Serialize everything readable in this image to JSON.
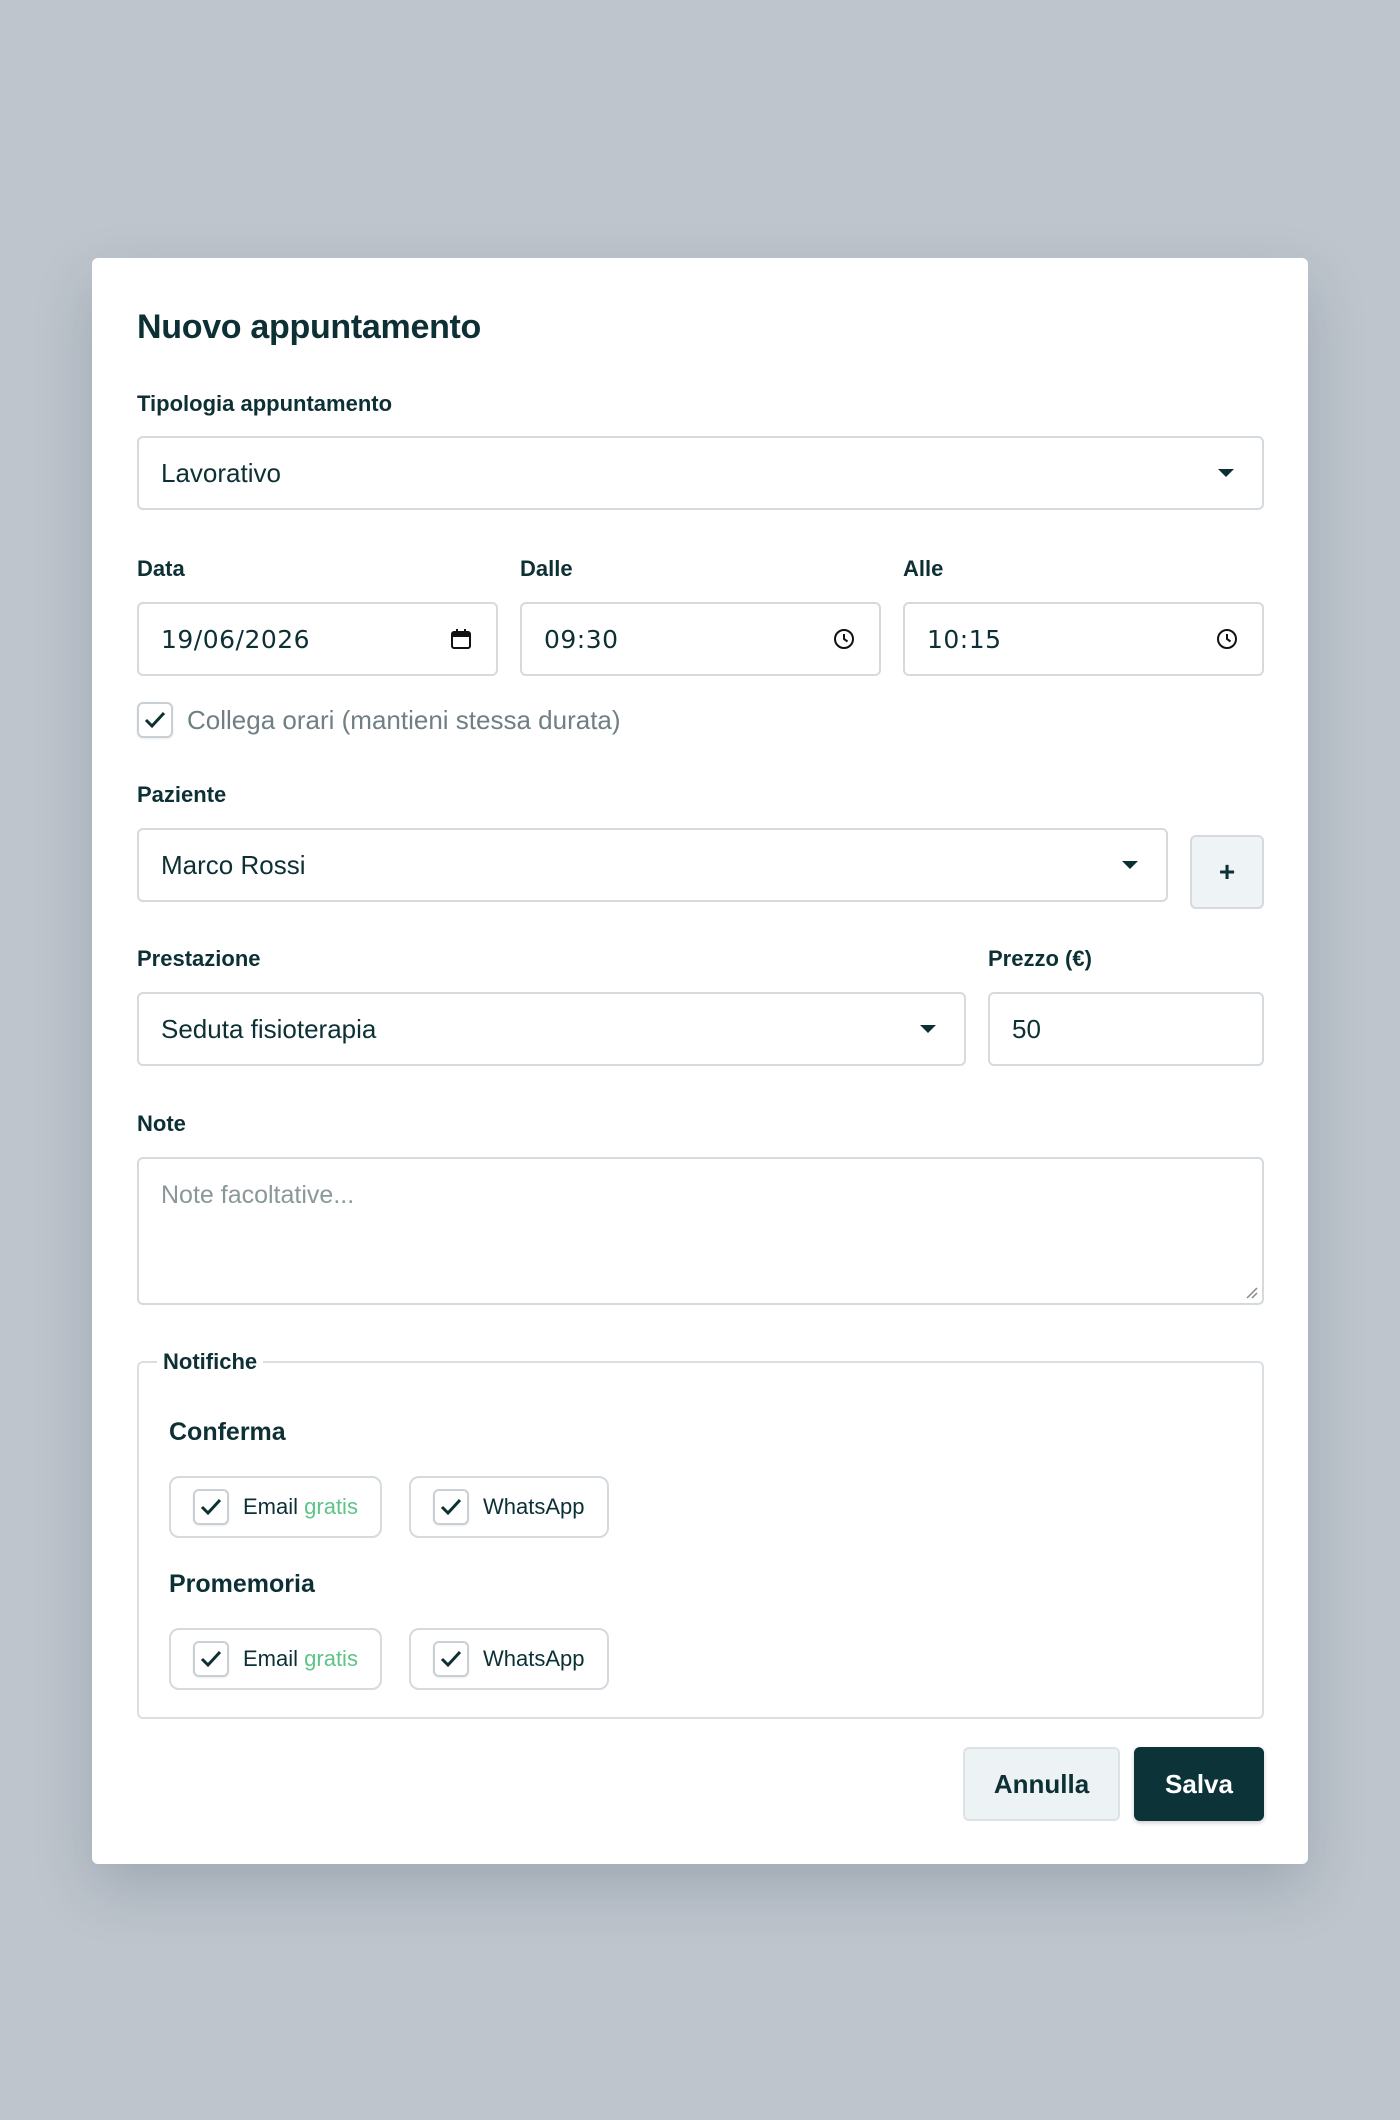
{
  "modal": {
    "title": "Nuovo appuntamento",
    "type": {
      "label": "Tipologia appuntamento",
      "value": "Lavorativo"
    },
    "date": {
      "label": "Data",
      "value": "19/06/2026"
    },
    "from": {
      "label": "Dalle",
      "value": "09:30"
    },
    "to": {
      "label": "Alle",
      "value": "10:15"
    },
    "link_times": {
      "label": "Collega orari (mantieni stessa durata)",
      "checked": true
    },
    "patient": {
      "label": "Paziente",
      "value": "Marco Rossi",
      "add_label": "+"
    },
    "service": {
      "label": "Prestazione",
      "value": "Seduta fisioterapia"
    },
    "price": {
      "label": "Prezzo (€)",
      "value": "50"
    },
    "notes": {
      "label": "Note",
      "placeholder": "Note facoltative..."
    },
    "notifications": {
      "legend": "Notifiche",
      "confirm": {
        "title": "Conferma",
        "email": {
          "label": "Email",
          "badge": "gratis",
          "checked": true
        },
        "whatsapp": {
          "label": "WhatsApp",
          "checked": true
        }
      },
      "reminder": {
        "title": "Promemoria",
        "email": {
          "label": "Email",
          "badge": "gratis",
          "checked": true
        },
        "whatsapp": {
          "label": "WhatsApp",
          "checked": true
        }
      }
    },
    "actions": {
      "cancel": "Annulla",
      "save": "Salva"
    }
  },
  "colors": {
    "primary": "#0b3338",
    "badge_green": "#5cc486",
    "backdrop": "#bec5cd"
  }
}
